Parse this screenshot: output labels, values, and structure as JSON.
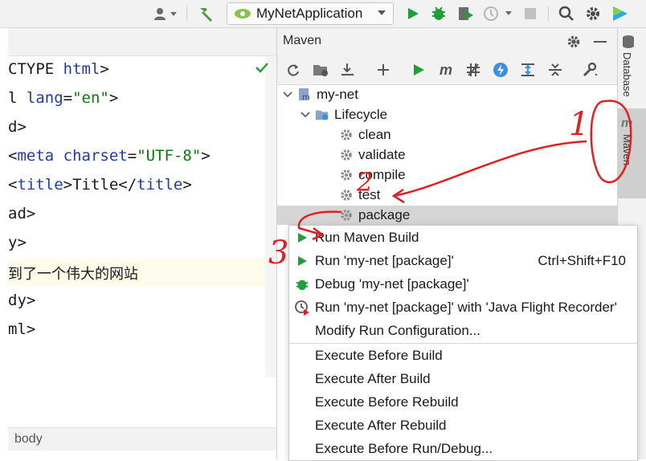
{
  "toolbar": {
    "run_config": "MyNetApplication",
    "icons": [
      "user-icon",
      "hammer-icon",
      "run-icon",
      "debug-icon",
      "coverage-icon",
      "profile-icon",
      "stop-icon",
      "search-icon",
      "settings-icon",
      "jetbrains-icon"
    ]
  },
  "editor": {
    "lines": [
      {
        "p1": "CTYPE ",
        "k": "html",
        "p2": ">"
      },
      {
        "p1": "l ",
        "k": "lang",
        "p2": "=",
        "s": "\"en\"",
        "p3": ">"
      },
      {
        "p1": "d>"
      },
      {
        "p1": "<",
        "k": "meta",
        "p2": " ",
        "k2": "charset",
        "p3": "=",
        "s": "\"UTF-8\"",
        "p4": ">"
      },
      {
        "p1": "<",
        "k": "title",
        "p2": ">Title</",
        "k2": "title",
        "p3": ">"
      },
      {
        "p1": "ad>"
      },
      {
        "p1": "y>"
      },
      {
        "p1": "到了一个伟大的网站"
      },
      {
        "p1": "dy>"
      },
      {
        "p1": "ml>"
      }
    ],
    "breadcrumb": "body"
  },
  "maven": {
    "title": "Maven",
    "project": "my-net",
    "lifecycle": "Lifecycle",
    "goals": [
      "clean",
      "validate",
      "compile",
      "test",
      "package"
    ]
  },
  "right_strip": {
    "database": "Database",
    "maven": "Maven"
  },
  "context_menu": {
    "items": [
      {
        "label": "Run Maven Build",
        "icon": "run-icon"
      },
      {
        "label": "Run 'my-net [package]'",
        "icon": "run-icon",
        "shortcut": "Ctrl+Shift+F10"
      },
      {
        "label": "Debug 'my-net [package]'",
        "icon": "debug-icon"
      },
      {
        "label": "Run 'my-net [package]' with 'Java Flight Recorder'",
        "icon": "profile-icon"
      },
      {
        "label": "Modify Run Configuration...",
        "icon": ""
      }
    ],
    "items2": [
      "Execute Before Build",
      "Execute After Build",
      "Execute Before Rebuild",
      "Execute After Rebuild",
      "Execute Before Run/Debug..."
    ]
  },
  "annotations": {
    "n1": "1",
    "n2": "2",
    "n3": "3"
  },
  "colors": {
    "accent_green": "#1f9e3a",
    "annotation_red": "#e02020",
    "keyword": "#1f3ca8",
    "string": "#0b7a0b"
  }
}
